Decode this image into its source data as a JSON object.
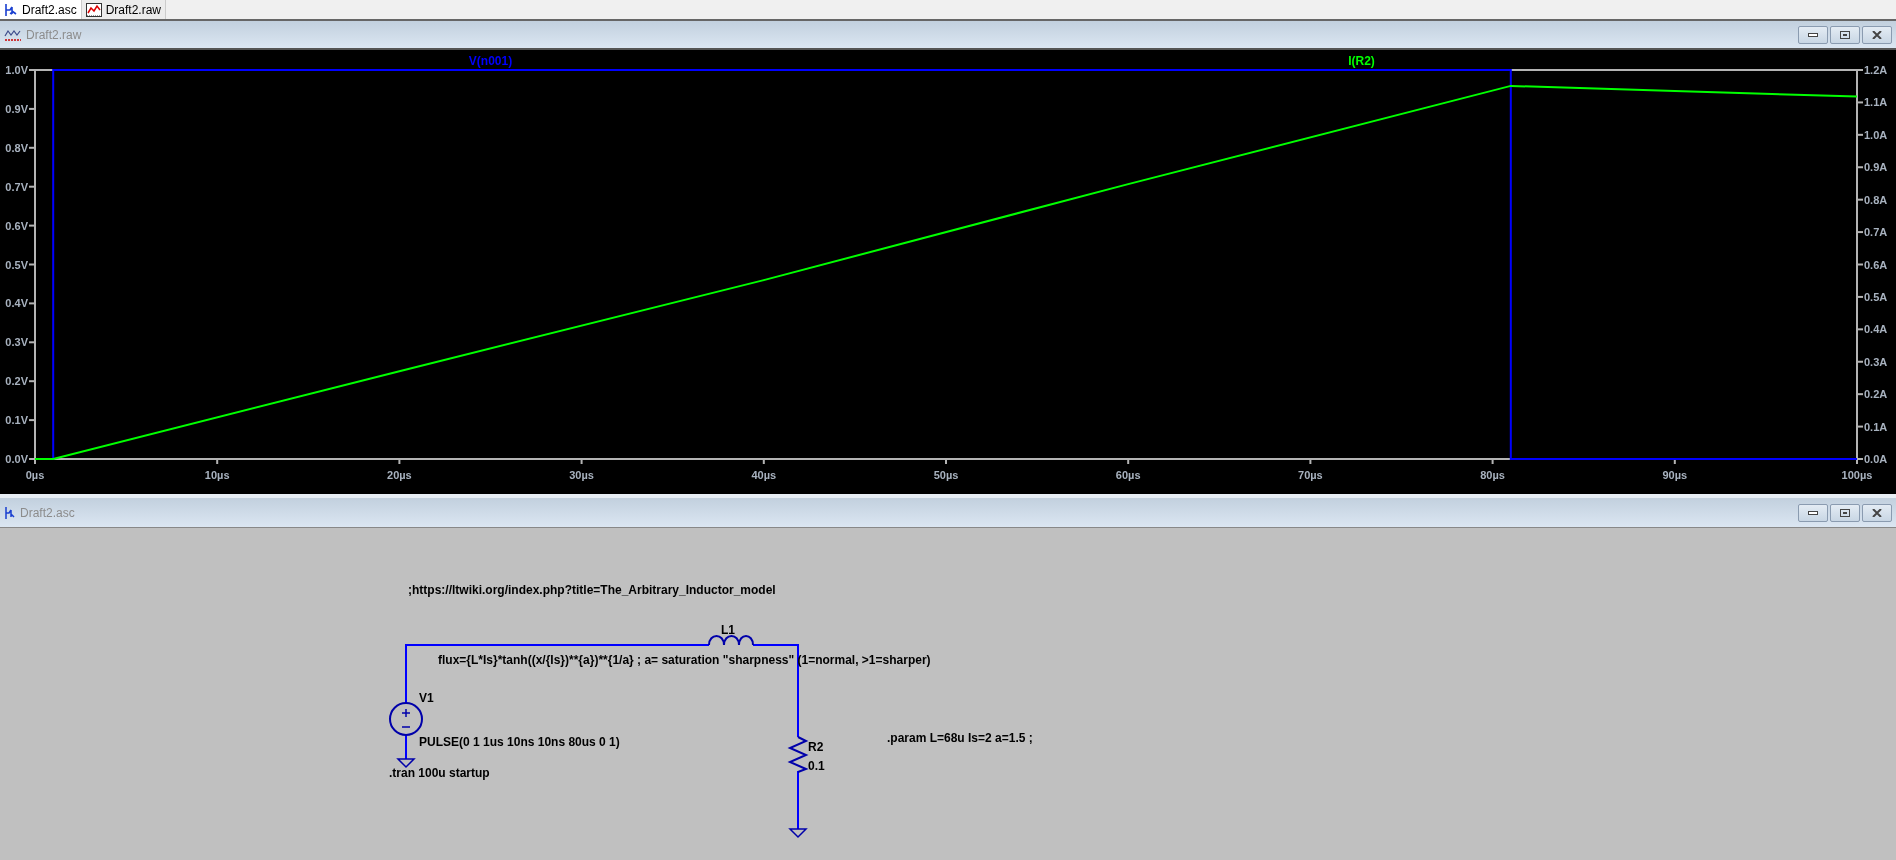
{
  "tabs": [
    {
      "label": "Draft2.asc",
      "selected": true,
      "kind": "schematic"
    },
    {
      "label": "Draft2.raw",
      "selected": false,
      "kind": "waveform"
    }
  ],
  "waveform_window": {
    "title": "Draft2.raw",
    "chart_data": {
      "type": "line",
      "x": [
        0,
        1,
        1,
        20,
        40,
        60,
        81,
        81,
        90,
        100
      ],
      "series": [
        {
          "name": "V(n001)",
          "color": "#0000ff",
          "values": [
            0,
            0,
            1,
            1,
            1,
            1,
            1,
            0,
            0,
            0
          ]
        },
        {
          "name": "I(R2)",
          "color": "#00ff00",
          "axis": "y2",
          "values": [
            0,
            0,
            0,
            0.271,
            0.552,
            0.848,
            1.151,
            1.151,
            1.135,
            1.118
          ]
        }
      ],
      "xlim": [
        0,
        100
      ],
      "ylim": [
        0,
        1
      ],
      "y2lim": [
        0,
        1.2
      ],
      "xticks": [
        {
          "value": 0,
          "label": "0µs"
        },
        {
          "value": 10,
          "label": "10µs"
        },
        {
          "value": 20,
          "label": "20µs"
        },
        {
          "value": 30,
          "label": "30µs"
        },
        {
          "value": 40,
          "label": "40µs"
        },
        {
          "value": 50,
          "label": "50µs"
        },
        {
          "value": 60,
          "label": "60µs"
        },
        {
          "value": 70,
          "label": "70µs"
        },
        {
          "value": 80,
          "label": "80µs"
        },
        {
          "value": 90,
          "label": "90µs"
        },
        {
          "value": 100,
          "label": "100µs"
        }
      ],
      "yticks": [
        {
          "value": 0,
          "label": "0.0V"
        },
        {
          "value": 0.1,
          "label": "0.1V"
        },
        {
          "value": 0.2,
          "label": "0.2V"
        },
        {
          "value": 0.3,
          "label": "0.3V"
        },
        {
          "value": 0.4,
          "label": "0.4V"
        },
        {
          "value": 0.5,
          "label": "0.5V"
        },
        {
          "value": 0.6,
          "label": "0.6V"
        },
        {
          "value": 0.7,
          "label": "0.7V"
        },
        {
          "value": 0.8,
          "label": "0.8V"
        },
        {
          "value": 0.9,
          "label": "0.9V"
        },
        {
          "value": 1,
          "label": "1.0V"
        }
      ],
      "y2ticks": [
        {
          "value": 0,
          "label": "0.0A"
        },
        {
          "value": 0.1,
          "label": "0.1A"
        },
        {
          "value": 0.2,
          "label": "0.2A"
        },
        {
          "value": 0.3,
          "label": "0.3A"
        },
        {
          "value": 0.4,
          "label": "0.4A"
        },
        {
          "value": 0.5,
          "label": "0.5A"
        },
        {
          "value": 0.6,
          "label": "0.6A"
        },
        {
          "value": 0.7,
          "label": "0.7A"
        },
        {
          "value": 0.8,
          "label": "0.8A"
        },
        {
          "value": 0.9,
          "label": "0.9A"
        },
        {
          "value": 1.0,
          "label": "1.0A"
        },
        {
          "value": 1.1,
          "label": "1.1A"
        },
        {
          "value": 1.2,
          "label": "1.2A"
        }
      ]
    }
  },
  "schematic_window": {
    "title": "Draft2.asc",
    "components": [
      {
        "kind": "inductor",
        "name": "L1",
        "value": "flux={L*Is}*tanh((x/{Is})**{a})**{1/a} ; a= saturation \"sharpness\" (1=normal, >1=sharper)"
      },
      {
        "kind": "voltage_source",
        "name": "V1",
        "value": "PULSE(0 1 1us 10ns 10ns 80us 0 1)"
      },
      {
        "kind": "resistor",
        "name": "R2",
        "value": "0.1"
      }
    ],
    "texts": [
      ";https://ltwiki.org/index.php?title=The_Arbitrary_Inductor_model",
      ".tran 100u startup",
      ".param L=68u Is=2 a=1.5 ;"
    ]
  }
}
